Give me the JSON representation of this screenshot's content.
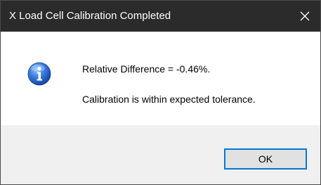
{
  "dialog": {
    "title": "X Load Cell Calibration Completed",
    "close_icon": "close-icon",
    "icon": "information-icon",
    "message_line1": "Relative Difference = -0.46%.",
    "message_line2": "Calibration is within expected tolerance.",
    "ok_label": "OK"
  },
  "colors": {
    "titlebar": "#2b2b2b",
    "title_text": "#ffffff",
    "content_bg": "#ffffff",
    "footer_bg": "#f0f0f0",
    "button_bg": "#e1e1e1",
    "button_border": "#0078d7",
    "icon_blue": "#1c5fc9"
  }
}
